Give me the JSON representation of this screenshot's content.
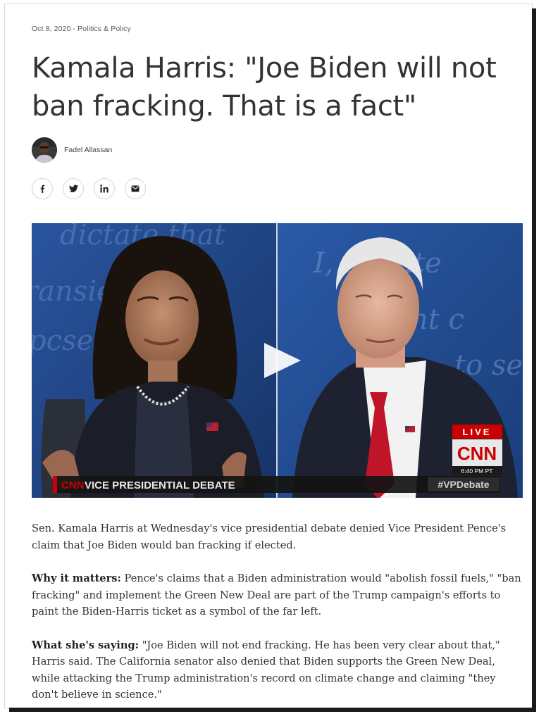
{
  "article": {
    "date": "Oct 8, 2020",
    "separator": " - ",
    "category": "Politics & Policy",
    "title": "Kamala Harris: \"Joe Biden will not ban fracking. That is a fact\"",
    "author": "Fadel Allassan"
  },
  "share": [
    {
      "name": "facebook-icon",
      "glyph": "f"
    },
    {
      "name": "twitter-icon",
      "glyph": "twitter"
    },
    {
      "name": "linkedin-icon",
      "glyph": "in"
    },
    {
      "name": "email-icon",
      "glyph": "mail"
    }
  ],
  "video": {
    "live_label": "LIVE",
    "network": "CNN",
    "time": "6:40 PM PT",
    "lower_third_logo": "CNN",
    "lower_third_text": "VICE PRESIDENTIAL DEBATE",
    "hashtag": "#VPDebate",
    "backdrop_text_left": [
      "dictate that",
      "ransie s;",
      "pcse"
    ],
    "backdrop_text_right": [
      "I, dictate",
      "sient c",
      "to se"
    ]
  },
  "body": {
    "p1": "Sen. Kamala Harris at Wednesday's vice presidential debate denied Vice President Pence's claim that Joe Biden would ban fracking if elected.",
    "p2_lead": "Why it matters:",
    "p2": " Pence's claims that a Biden administration would \"abolish fossil fuels,\" \"ban fracking\" and implement the Green New Deal are part of the Trump campaign's efforts to paint the Biden-Harris ticket as a symbol of the far left.",
    "p3_lead": "What she's saying:",
    "p3": " \"Joe Biden will not end fracking. He has been very clear about that,\" Harris said. The California senator also denied that Biden supports the Green New Deal, while attacking the Trump administration's record on climate change and claiming \"they don't believe in science.\""
  },
  "colors": {
    "title": "#333333",
    "backdrop_blue": "#1d3e7a",
    "cnn_red": "#cc0000",
    "tie_red": "#c0142a"
  }
}
